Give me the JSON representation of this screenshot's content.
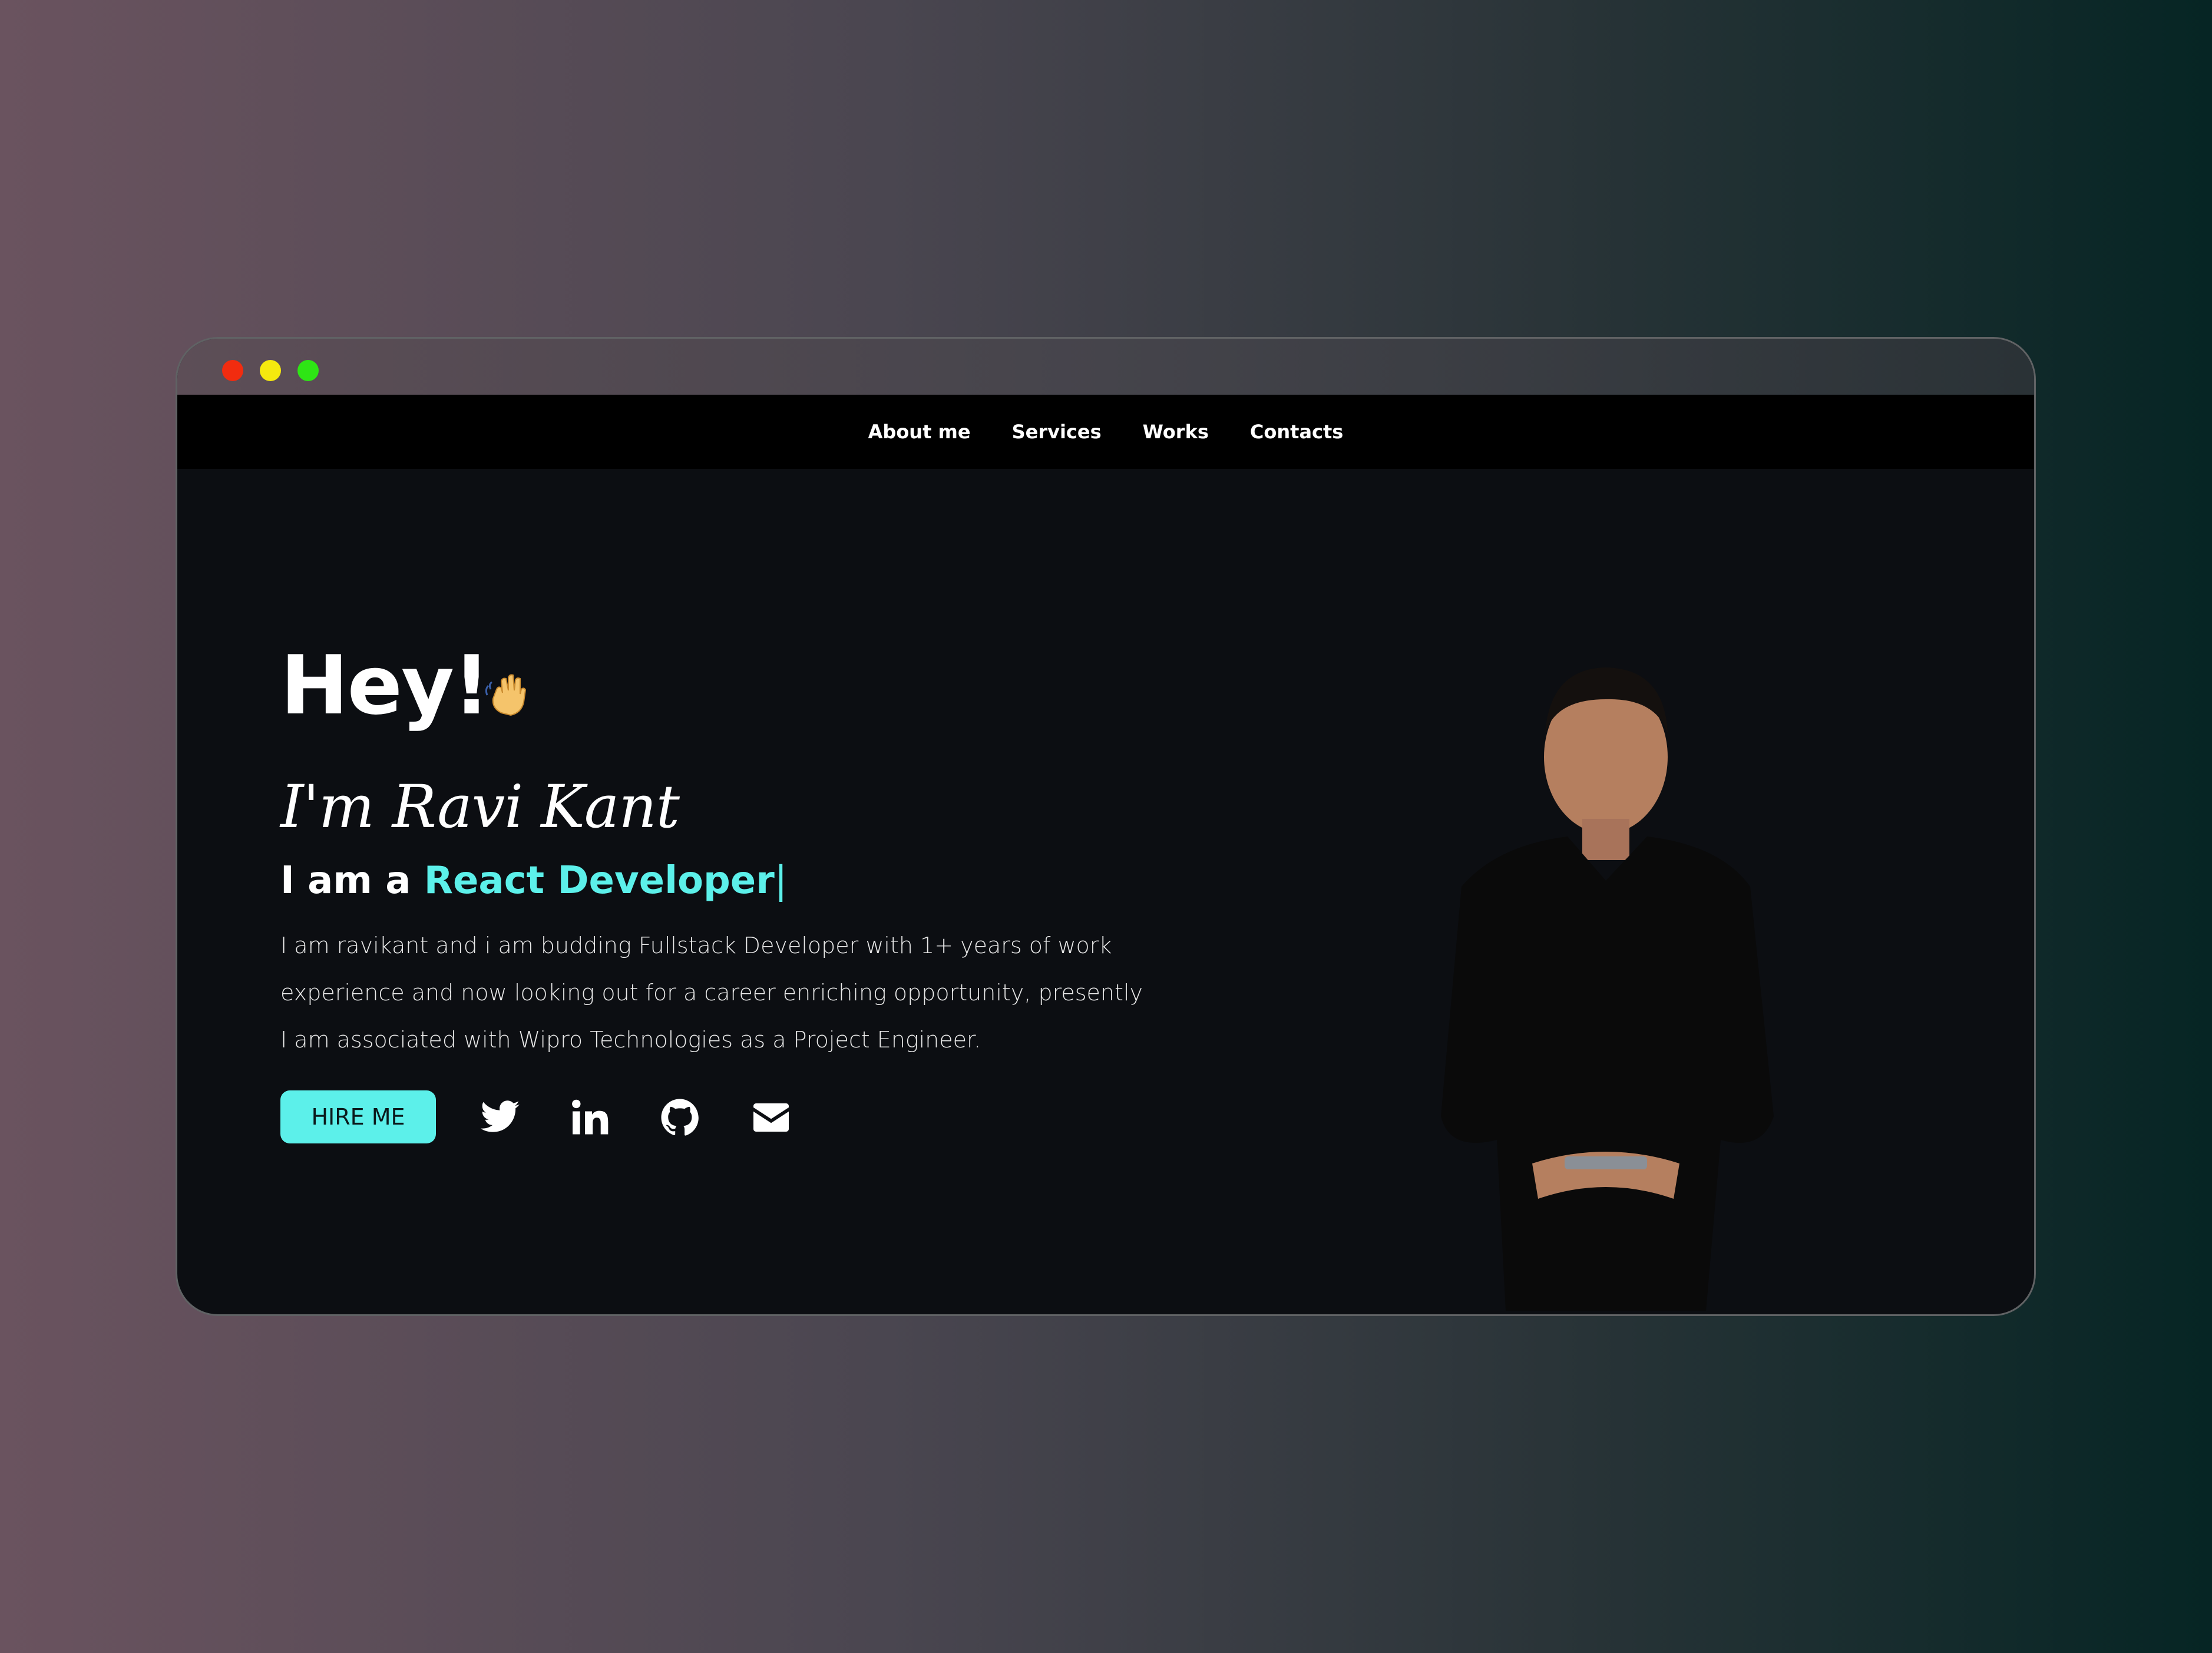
{
  "window": {
    "controls": [
      "close",
      "minimize",
      "maximize"
    ]
  },
  "nav": {
    "items": [
      {
        "label": "About me"
      },
      {
        "label": "Services"
      },
      {
        "label": "Works"
      },
      {
        "label": "Contacts"
      }
    ]
  },
  "hero": {
    "greeting": "Hey!",
    "greeting_icon": "waving-hand-icon",
    "name": "I'm Ravi Kant",
    "role_prefix": "I am a",
    "role_highlight": "React Developer",
    "role_cursor": "|",
    "bio": "I am ravikant and i am budding Fullstack Developer with 1+ years of work experience and now looking out for a career enriching opportunity, presently I am associated with Wipro Technologies as a Project Engineer.",
    "hire_label": "HIRE ME",
    "social_icons": [
      "twitter-icon",
      "linkedin-icon",
      "github-icon",
      "email-icon"
    ]
  },
  "colors": {
    "accent": "#5cf0ea",
    "accent_green": "#6af0a0",
    "background": "#0c0e12",
    "navbar": "#000000"
  }
}
